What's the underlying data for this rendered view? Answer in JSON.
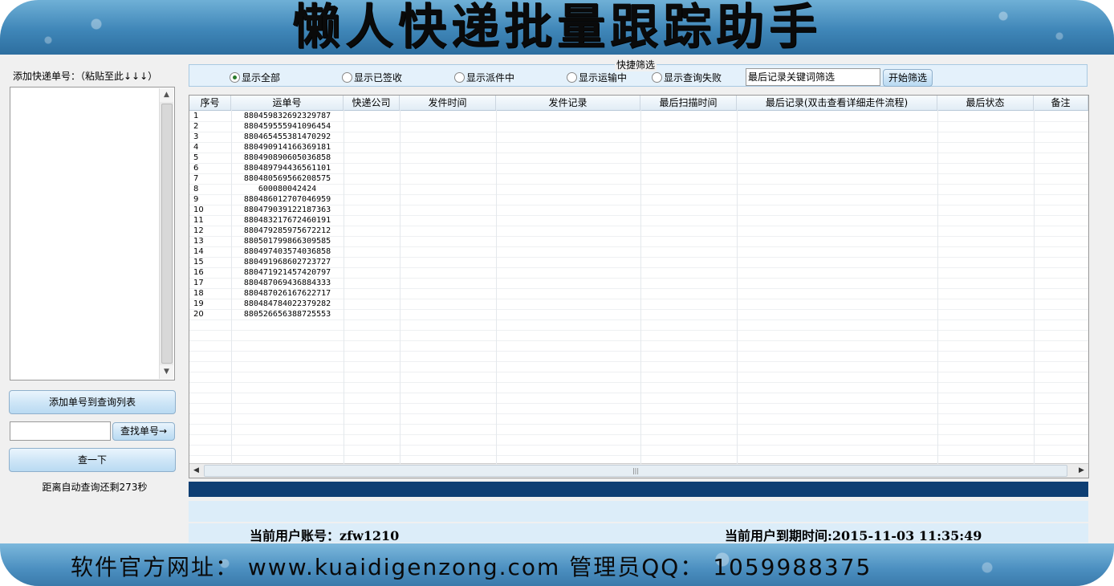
{
  "banner": {
    "title": "懒人快递批量跟踪助手"
  },
  "left": {
    "add_label": "添加快递单号：（粘贴至此↓↓↓）",
    "add_button": "添加单号到查询列表",
    "find_button": "查找单号→",
    "query_button": "查一下",
    "countdown": "距离自动查询还剩273秒"
  },
  "filter": {
    "title": "快捷筛选",
    "options": [
      "显示全部",
      "显示已签收",
      "显示派件中",
      "显示运输中",
      "显示查询失败"
    ],
    "selected": "显示全部",
    "keyword_value": "最后记录关键词筛选",
    "filter_button": "开始筛选"
  },
  "table": {
    "columns": [
      "序号",
      "运单号",
      "快递公司",
      "发件时间",
      "发件记录",
      "最后扫描时间",
      "最后记录(双击查看详细走件流程)",
      "最后状态",
      "备注"
    ],
    "rows": [
      [
        "1",
        "880459832692329787"
      ],
      [
        "2",
        "880459555941096454"
      ],
      [
        "3",
        "880465455381470292"
      ],
      [
        "4",
        "880490914166369181"
      ],
      [
        "5",
        "880490890605036858"
      ],
      [
        "6",
        "880489794436561101"
      ],
      [
        "7",
        "880480569566208575"
      ],
      [
        "8",
        "600080042424"
      ],
      [
        "9",
        "880486012707046959"
      ],
      [
        "10",
        "880479039122187363"
      ],
      [
        "11",
        "880483217672460191"
      ],
      [
        "12",
        "880479285975672212"
      ],
      [
        "13",
        "880501799866309585"
      ],
      [
        "14",
        "880497403574036858"
      ],
      [
        "15",
        "880491968602723727"
      ],
      [
        "16",
        "880471921457420797"
      ],
      [
        "17",
        "880487069436884333"
      ],
      [
        "18",
        "880487026167622717"
      ],
      [
        "19",
        "880484784022379282"
      ],
      [
        "20",
        "880526656388725553"
      ]
    ]
  },
  "status": {
    "account": "当前用户账号：zfw1210",
    "expire": "当前用户到期时间:2015-11-03 11:35:49"
  },
  "footer": {
    "text": "软件官方网址： www.kuaidigenzong.com  管理员QQ： 1059988375"
  },
  "colors": {
    "progress": "#0e3e73",
    "banner": "#3f86b8"
  }
}
